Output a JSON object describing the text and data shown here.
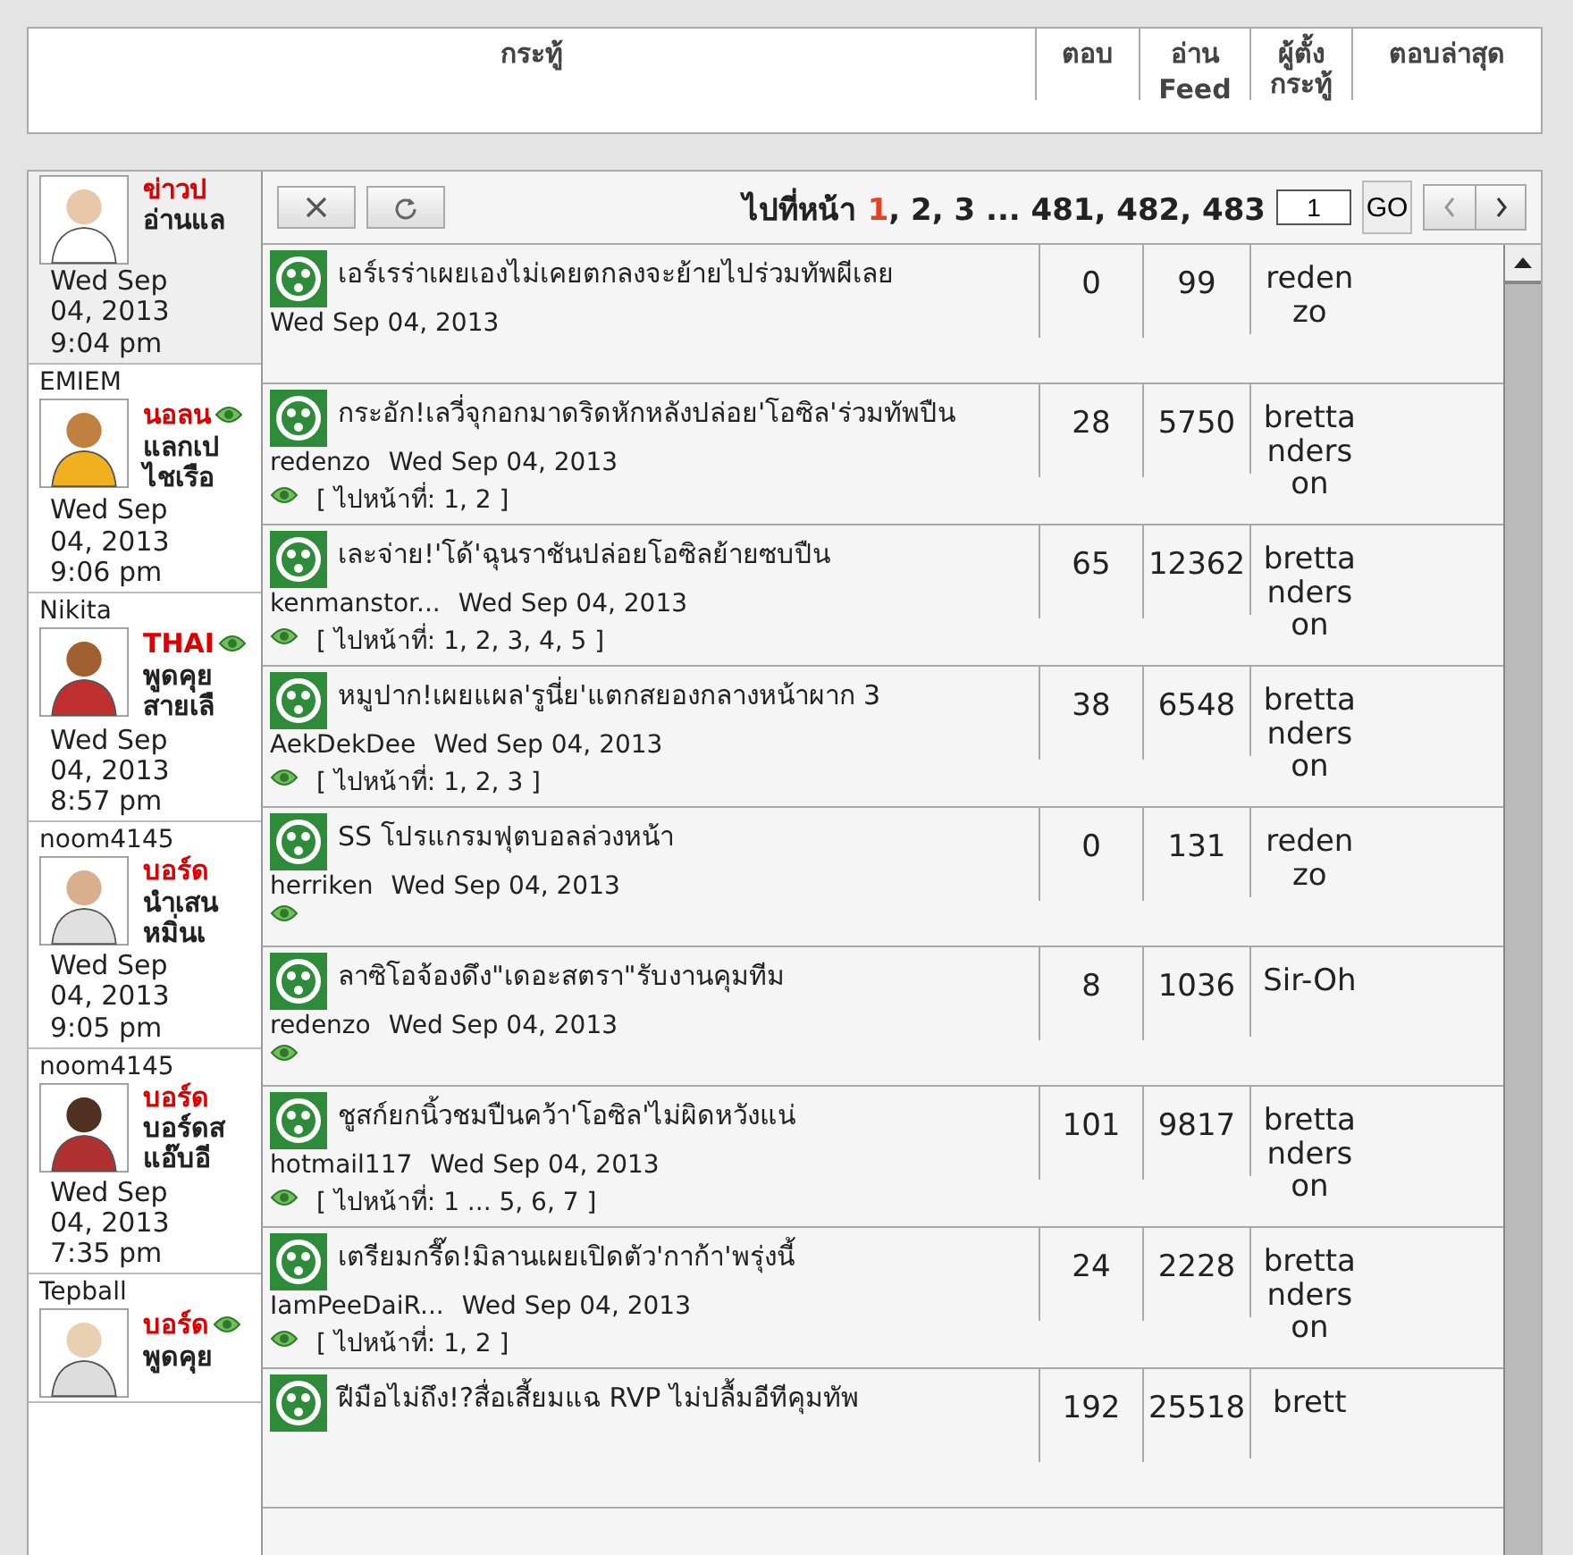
{
  "header": {
    "columns": [
      {
        "label": "กระทู้"
      },
      {
        "label": "ตอบ"
      },
      {
        "label": "อ่าน",
        "extra": "Feed"
      },
      {
        "label": "ผู้ตั้งกระทู้"
      },
      {
        "label": "ตอบล่าสุด"
      }
    ]
  },
  "forum_list": [
    {
      "title": "ข่าวป",
      "lines": [
        "อ่านแล"
      ],
      "watched": false,
      "date": [
        "Wed Sep",
        "04, 2013",
        "9:04 pm"
      ]
    },
    {
      "username": "EMIEM",
      "title": "นอลน",
      "lines": [
        "แลกเป",
        "ไชเรือ"
      ],
      "watched": true,
      "date": [
        "Wed Sep",
        "04, 2013",
        "9:06 pm"
      ]
    },
    {
      "username": "Nikita",
      "title": "THAI",
      "lines": [
        "พูดคุย",
        "สายเลื"
      ],
      "watched": true,
      "date": [
        "Wed Sep",
        "04, 2013",
        "8:57 pm"
      ]
    },
    {
      "username": "noom4145",
      "title": "บอร์ด",
      "lines": [
        "นำเสน",
        "หมิ่นเ"
      ],
      "watched": false,
      "date": [
        "Wed Sep",
        "04, 2013",
        "9:05 pm"
      ]
    },
    {
      "username": "noom4145",
      "title": "บอร์ด",
      "lines": [
        "บอร์ดส",
        "แอ๊บอี"
      ],
      "watched": false,
      "date": [
        "Wed Sep",
        "04, 2013",
        "7:35 pm"
      ]
    },
    {
      "username": "Tepball",
      "title": "บอร์ด",
      "lines": [
        "พูดคุย"
      ],
      "watched": true
    }
  ],
  "popup": {
    "pager": {
      "prefix": "ไปที่หน้า",
      "pages": [
        {
          "label": "1",
          "selected": true
        },
        {
          "label": ", 2, 3 ... 481, 482, 483",
          "selected": false
        }
      ],
      "page_input": "1",
      "go": "GO"
    },
    "topics": [
      {
        "title": "เอร์เรร่าเผยเองไม่เคยตกลงจะย้ายไปร่วมทัพผีเลย",
        "date": "Wed Sep 04, 2013",
        "watched": false,
        "replies": "0",
        "reads": "99",
        "last_poster": "redenzo"
      },
      {
        "title": "กระอัก!เลวี่จุกอกมาดริดหักหลังปล่อย'โอซิล'ร่วมทัพปืน",
        "author": "redenzo",
        "date": "Wed Sep 04, 2013",
        "watched": true,
        "pages": "[ ไปหน้าที่: 1, 2 ]",
        "replies": "28",
        "reads": "5750",
        "last_poster": "brettanderson"
      },
      {
        "title": "เละจ่าย!'โด้'ฉุนราชันปล่อยโอซิลย้ายซบปืน",
        "author": "kenmanstor...",
        "date": "Wed Sep 04, 2013",
        "watched": true,
        "pages": "[ ไปหน้าที่: 1, 2, 3, 4, 5 ]",
        "replies": "65",
        "reads": "12362",
        "last_poster": "brettanderson"
      },
      {
        "title": "หมูปาก!เผยแผล'รูนี่ย'แตกสยองกลางหน้าผาก 3",
        "author": "AekDekDee",
        "date": "Wed Sep 04, 2013",
        "watched": true,
        "pages": "[ ไปหน้าที่: 1, 2, 3 ]",
        "replies": "38",
        "reads": "6548",
        "last_poster": "brettanderson"
      },
      {
        "title": "SS โปรแกรมฟุตบอลล่วงหน้า",
        "author": "herriken",
        "date": "Wed Sep 04, 2013",
        "watched": true,
        "replies": "0",
        "reads": "131",
        "last_poster": "redenzo"
      },
      {
        "title": "ลาซิโอจ้องดึง\"เดอะสตรา\"รับงานคุมทีม",
        "author": "redenzo",
        "date": "Wed Sep 04, 2013",
        "watched": true,
        "replies": "8",
        "reads": "1036",
        "last_poster": "Sir-Oh"
      },
      {
        "title": "ชูสก์ยกนิ้วชมปืนคว้า'โอซิล'ไม่ผิดหวังแน่",
        "author": "hotmail117",
        "date": "Wed Sep 04, 2013",
        "watched": true,
        "pages": "[ ไปหน้าที่: 1 ... 5, 6, 7 ]",
        "replies": "101",
        "reads": "9817",
        "last_poster": "brettanderson"
      },
      {
        "title": "เตรียมกรี๊ด!มิลานเผยเปิดตัว'กาก้า'พรุ่งนี้",
        "author": "IamPeeDaiR...",
        "date": "Wed Sep 04, 2013",
        "watched": true,
        "pages": "[ ไปหน้าที่: 1, 2 ]",
        "replies": "24",
        "reads": "2228",
        "last_poster": "brettanderson"
      },
      {
        "title": "ฝีมือไม่ถึง!?สื่อเสี้ยมแฉ RVP ไม่ปลื้มอีทีคุมทัพ",
        "watched": false,
        "replies": "192",
        "reads": "25518",
        "last_poster": "brett"
      }
    ]
  }
}
